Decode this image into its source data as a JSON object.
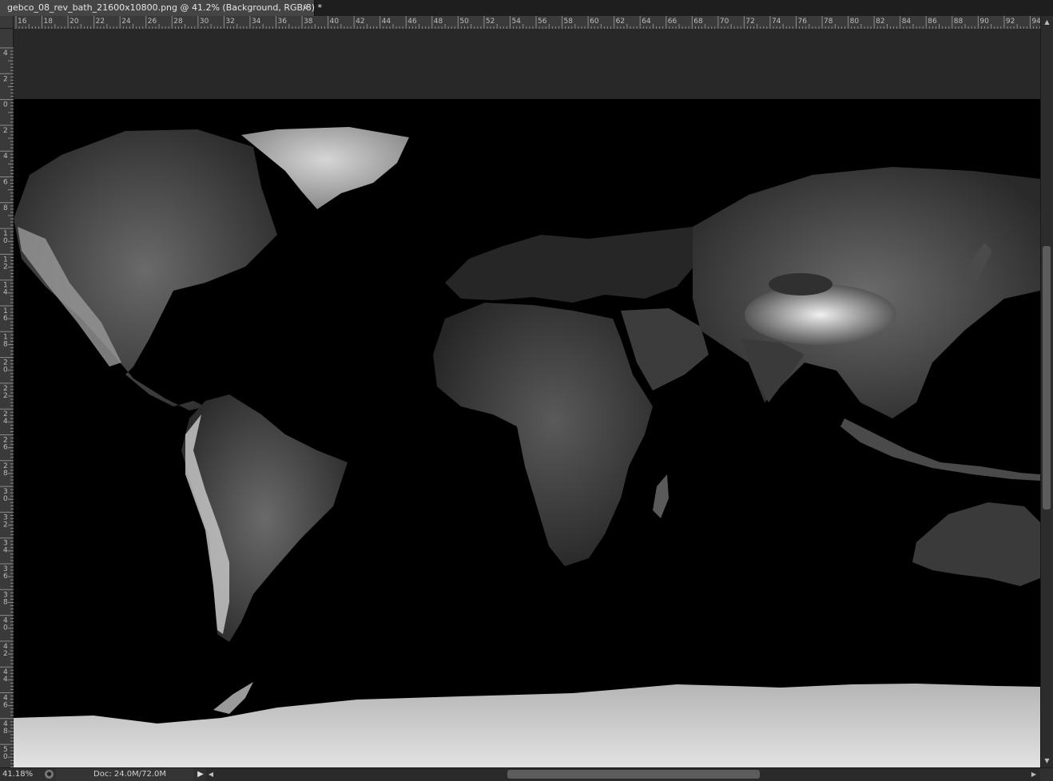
{
  "document_tab": {
    "title": "gebco_08_rev_bath_21600x10800.png @ 41.2% (Background, RGB/8) *",
    "close_glyph": "×"
  },
  "ruler_horizontal": [
    "16",
    "18",
    "20",
    "22",
    "24",
    "26",
    "28",
    "30",
    "32",
    "34",
    "36",
    "38",
    "40",
    "42",
    "44",
    "46",
    "48",
    "50",
    "52",
    "54",
    "56",
    "58",
    "60",
    "62",
    "64",
    "66",
    "68",
    "70",
    "72",
    "74",
    "76",
    "78",
    "80",
    "82",
    "84",
    "86",
    "88",
    "90",
    "92",
    "94"
  ],
  "ruler_vertical": [
    "4",
    "2",
    "0",
    "2",
    "4",
    "6",
    "8",
    "10",
    "12",
    "14",
    "16",
    "18",
    "20",
    "22",
    "24",
    "26",
    "28",
    "30",
    "32",
    "34",
    "36",
    "38",
    "40",
    "42",
    "44",
    "46",
    "48",
    "50"
  ],
  "status_bar": {
    "zoom": "41.18%",
    "doc_info": "Doc: 24.0M/72.0M",
    "menu_arrow": "▶"
  },
  "scroll_arrows": {
    "up": "▲",
    "down": "▼",
    "left": "◀",
    "right": "▶"
  },
  "colors": {
    "land_highlight": "#e8e8e8",
    "ocean": "#000000",
    "ui_background": "#282828"
  }
}
